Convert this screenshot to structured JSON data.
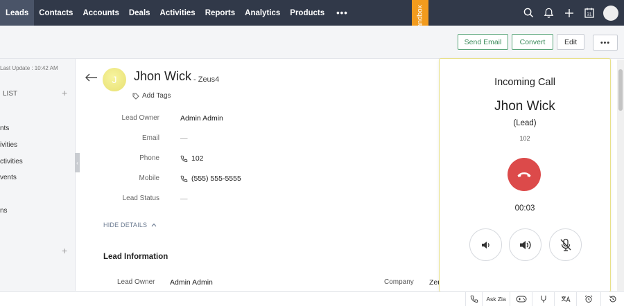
{
  "nav": {
    "items": [
      "Leads",
      "Contacts",
      "Accounts",
      "Deals",
      "Activities",
      "Reports",
      "Analytics",
      "Products"
    ],
    "more": "•••",
    "sandbox": "Sandbox"
  },
  "toolbar": {
    "send_email": "Send Email",
    "convert": "Convert",
    "edit": "Edit",
    "more": "•••"
  },
  "sidebar": {
    "last_update": "Last Update : 10:42 AM",
    "list_header": "LIST",
    "items": [
      "nts",
      "ivities",
      "ctivities",
      "vents",
      "ns"
    ]
  },
  "lead": {
    "avatar_letter": "J",
    "name": "Jhon Wick",
    "company": "- Zeus4",
    "add_tags": "Add Tags",
    "fields": [
      {
        "label": "Lead Owner",
        "value": "Admin Admin"
      },
      {
        "label": "Email",
        "value": "—"
      },
      {
        "label": "Phone",
        "value": "102"
      },
      {
        "label": "Mobile",
        "value": "(555) 555-5555"
      },
      {
        "label": "Lead Status",
        "value": "—"
      }
    ],
    "hide_details": "HIDE DETAILS",
    "section_title": "Lead Information",
    "info": {
      "owner_label": "Lead Owner",
      "owner_value": "Admin Admin",
      "company_label": "Company",
      "company_value": "Zeu"
    }
  },
  "call": {
    "title": "Incoming Call",
    "name": "Jhon Wick",
    "type": "(Lead)",
    "number": "102",
    "timer": "00:03"
  },
  "bottombar": {
    "ask_zia": "Ask Zia"
  },
  "colors": {
    "nav_bg": "#313949",
    "sandbox": "#f29b1d",
    "hangup": "#dc4a4a",
    "convert": "#5aa57a"
  }
}
